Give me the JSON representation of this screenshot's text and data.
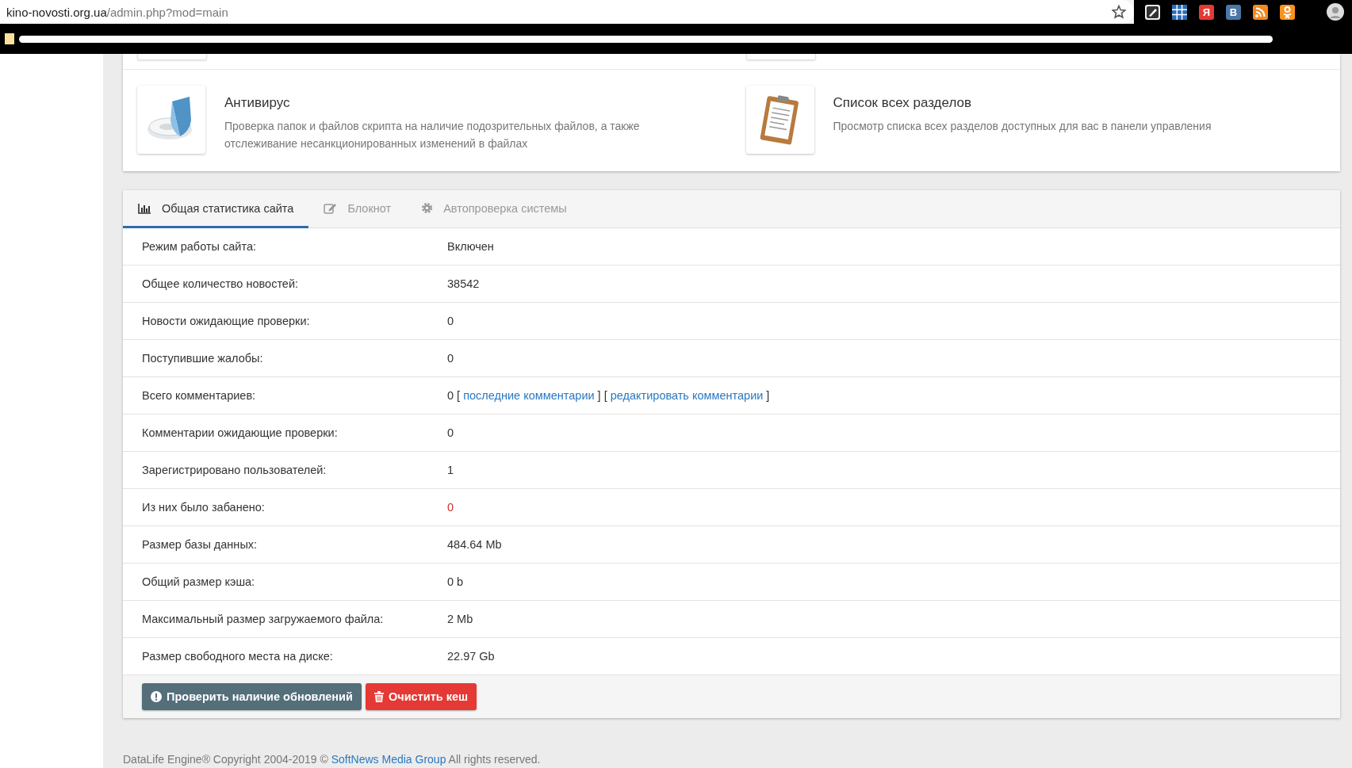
{
  "browser": {
    "url_host": "kino-novosti.org.ua",
    "url_path": "/admin.php?mod=main",
    "bookmarked": false,
    "extensions": [
      {
        "kind": "pen"
      },
      {
        "kind": "grid"
      },
      {
        "kind": "letter",
        "text": "Я",
        "color": "#e53935"
      },
      {
        "kind": "letter",
        "text": "B",
        "color": "#4a76a8"
      },
      {
        "kind": "rss"
      },
      {
        "kind": "person"
      }
    ]
  },
  "quick_cards": [
    {
      "kind": "antivirus",
      "title": "Антивирус",
      "description": "Проверка папок и файлов скрипта на наличие подозрительных файлов, а также отслеживание несанкционированных изменений в файлах"
    },
    {
      "kind": "clipboard",
      "title": "Список всех разделов",
      "description": "Просмотр списка всех разделов доступных для вас в панели управления"
    }
  ],
  "tabs": [
    {
      "kind": "chart",
      "label": "Общая статистика сайта",
      "selected": true
    },
    {
      "kind": "edit",
      "label": "Блокнот",
      "selected": false
    },
    {
      "kind": "gear",
      "label": "Автопроверка системы",
      "selected": false
    }
  ],
  "stats": [
    {
      "label": "Режим работы сайта:",
      "kind": "text",
      "value": "Включен",
      "alert": false
    },
    {
      "label": "Общее количество новостей:",
      "kind": "text",
      "value": "38542",
      "alert": false
    },
    {
      "label": "Новости ожидающие проверки:",
      "kind": "text",
      "value": "0",
      "alert": false
    },
    {
      "label": "Поступившие жалобы:",
      "kind": "text",
      "value": "0",
      "alert": false
    },
    {
      "label": "Всего комментариев:",
      "kind": "links",
      "parts": [
        {
          "text": "0 [ ",
          "kind": "plain"
        },
        {
          "text": "последние комментарии",
          "kind": "link"
        },
        {
          "text": " ] [ ",
          "kind": "plain"
        },
        {
          "text": "редактировать комментарии",
          "kind": "link"
        },
        {
          "text": " ]",
          "kind": "plain"
        }
      ],
      "alert": false
    },
    {
      "label": "Комментарии ожидающие проверки:",
      "kind": "text",
      "value": "0",
      "alert": false
    },
    {
      "label": "Зарегистрировано пользователей:",
      "kind": "text",
      "value": "1",
      "alert": false
    },
    {
      "label": "Из них было забанено:",
      "kind": "text",
      "value": "0",
      "alert": true
    },
    {
      "label": "Размер базы данных:",
      "kind": "text",
      "value": "484.64 Mb",
      "alert": false
    },
    {
      "label": "Общий размер кэша:",
      "kind": "text",
      "value": "0 b",
      "alert": false
    },
    {
      "label": "Максимальный размер загружаемого файла:",
      "kind": "text",
      "value": "2 Mb",
      "alert": false
    },
    {
      "label": "Размер свободного места на диске:",
      "kind": "text",
      "value": "22.97 Gb",
      "alert": false
    }
  ],
  "buttons": [
    {
      "kind": "check",
      "label": "Проверить наличие обновлений"
    },
    {
      "kind": "clear",
      "label": "Очистить кеш"
    }
  ],
  "footer": {
    "before": "DataLife Engine® Copyright 2004-2019 © ",
    "link": "SoftNews Media Group",
    "after": " All rights reserved."
  }
}
